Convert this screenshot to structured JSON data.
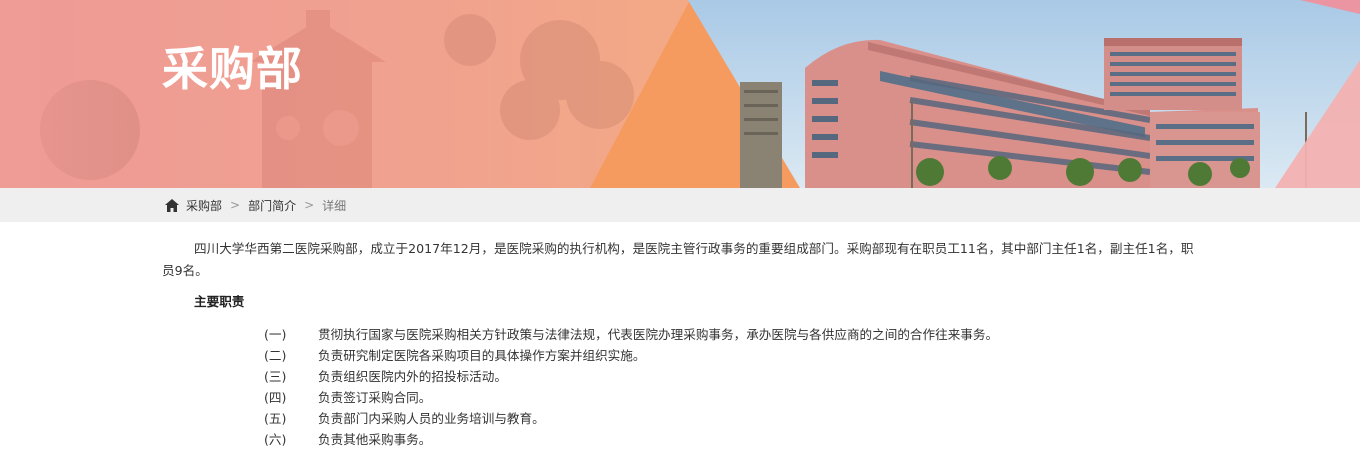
{
  "banner": {
    "title": "采购部"
  },
  "breadcrumb": {
    "home_icon": "home-icon",
    "items": [
      "采购部",
      "部门简介",
      "详细"
    ],
    "separator": ">"
  },
  "content": {
    "intro": "四川大学华西第二医院采购部，成立于2017年12月，是医院采购的执行机构，是医院主管行政事务的重要组成部门。采购部现有在职员工11名，其中部门主任1名，副主任1名，职员9名。",
    "duties_heading": "主要职责",
    "duties": [
      {
        "num": "(一)",
        "text": "贯彻执行国家与医院采购相关方针政策与法律法规，代表医院办理采购事务，承办医院与各供应商的之间的合作往来事务。"
      },
      {
        "num": "(二)",
        "text": "负责研究制定医院各采购项目的具体操作方案并组织实施。"
      },
      {
        "num": "(三)",
        "text": "负责组织医院内外的招投标活动。"
      },
      {
        "num": "(四)",
        "text": "负责签订采购合同。"
      },
      {
        "num": "(五)",
        "text": "负责部门内采购人员的业务培训与教育。"
      },
      {
        "num": "(六)",
        "text": "负责其他采购事务。"
      }
    ]
  },
  "colors": {
    "banner_pink": "#ee9a96",
    "banner_orange": "#f6a36f",
    "breadcrumb_bg": "#efefef",
    "building_pink": "#d98f8a"
  }
}
